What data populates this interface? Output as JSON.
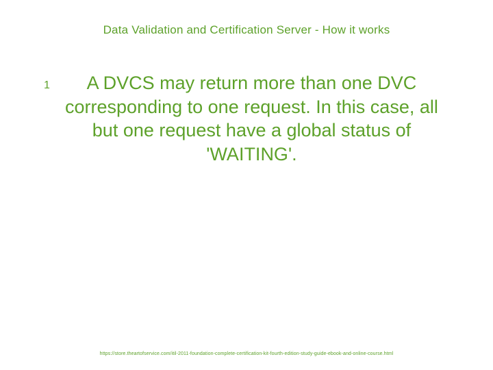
{
  "title": "Data Validation and Certification Server - How it works",
  "bullet": {
    "number": "1",
    "text": "A DVCS may return more than one DVC corresponding to one request.  In this case, all but one request have a global status of 'WAITING'."
  },
  "footer": "https://store.theartofservice.com/itil-2011-foundation-complete-certification-kit-fourth-edition-study-guide-ebook-and-online-course.html"
}
